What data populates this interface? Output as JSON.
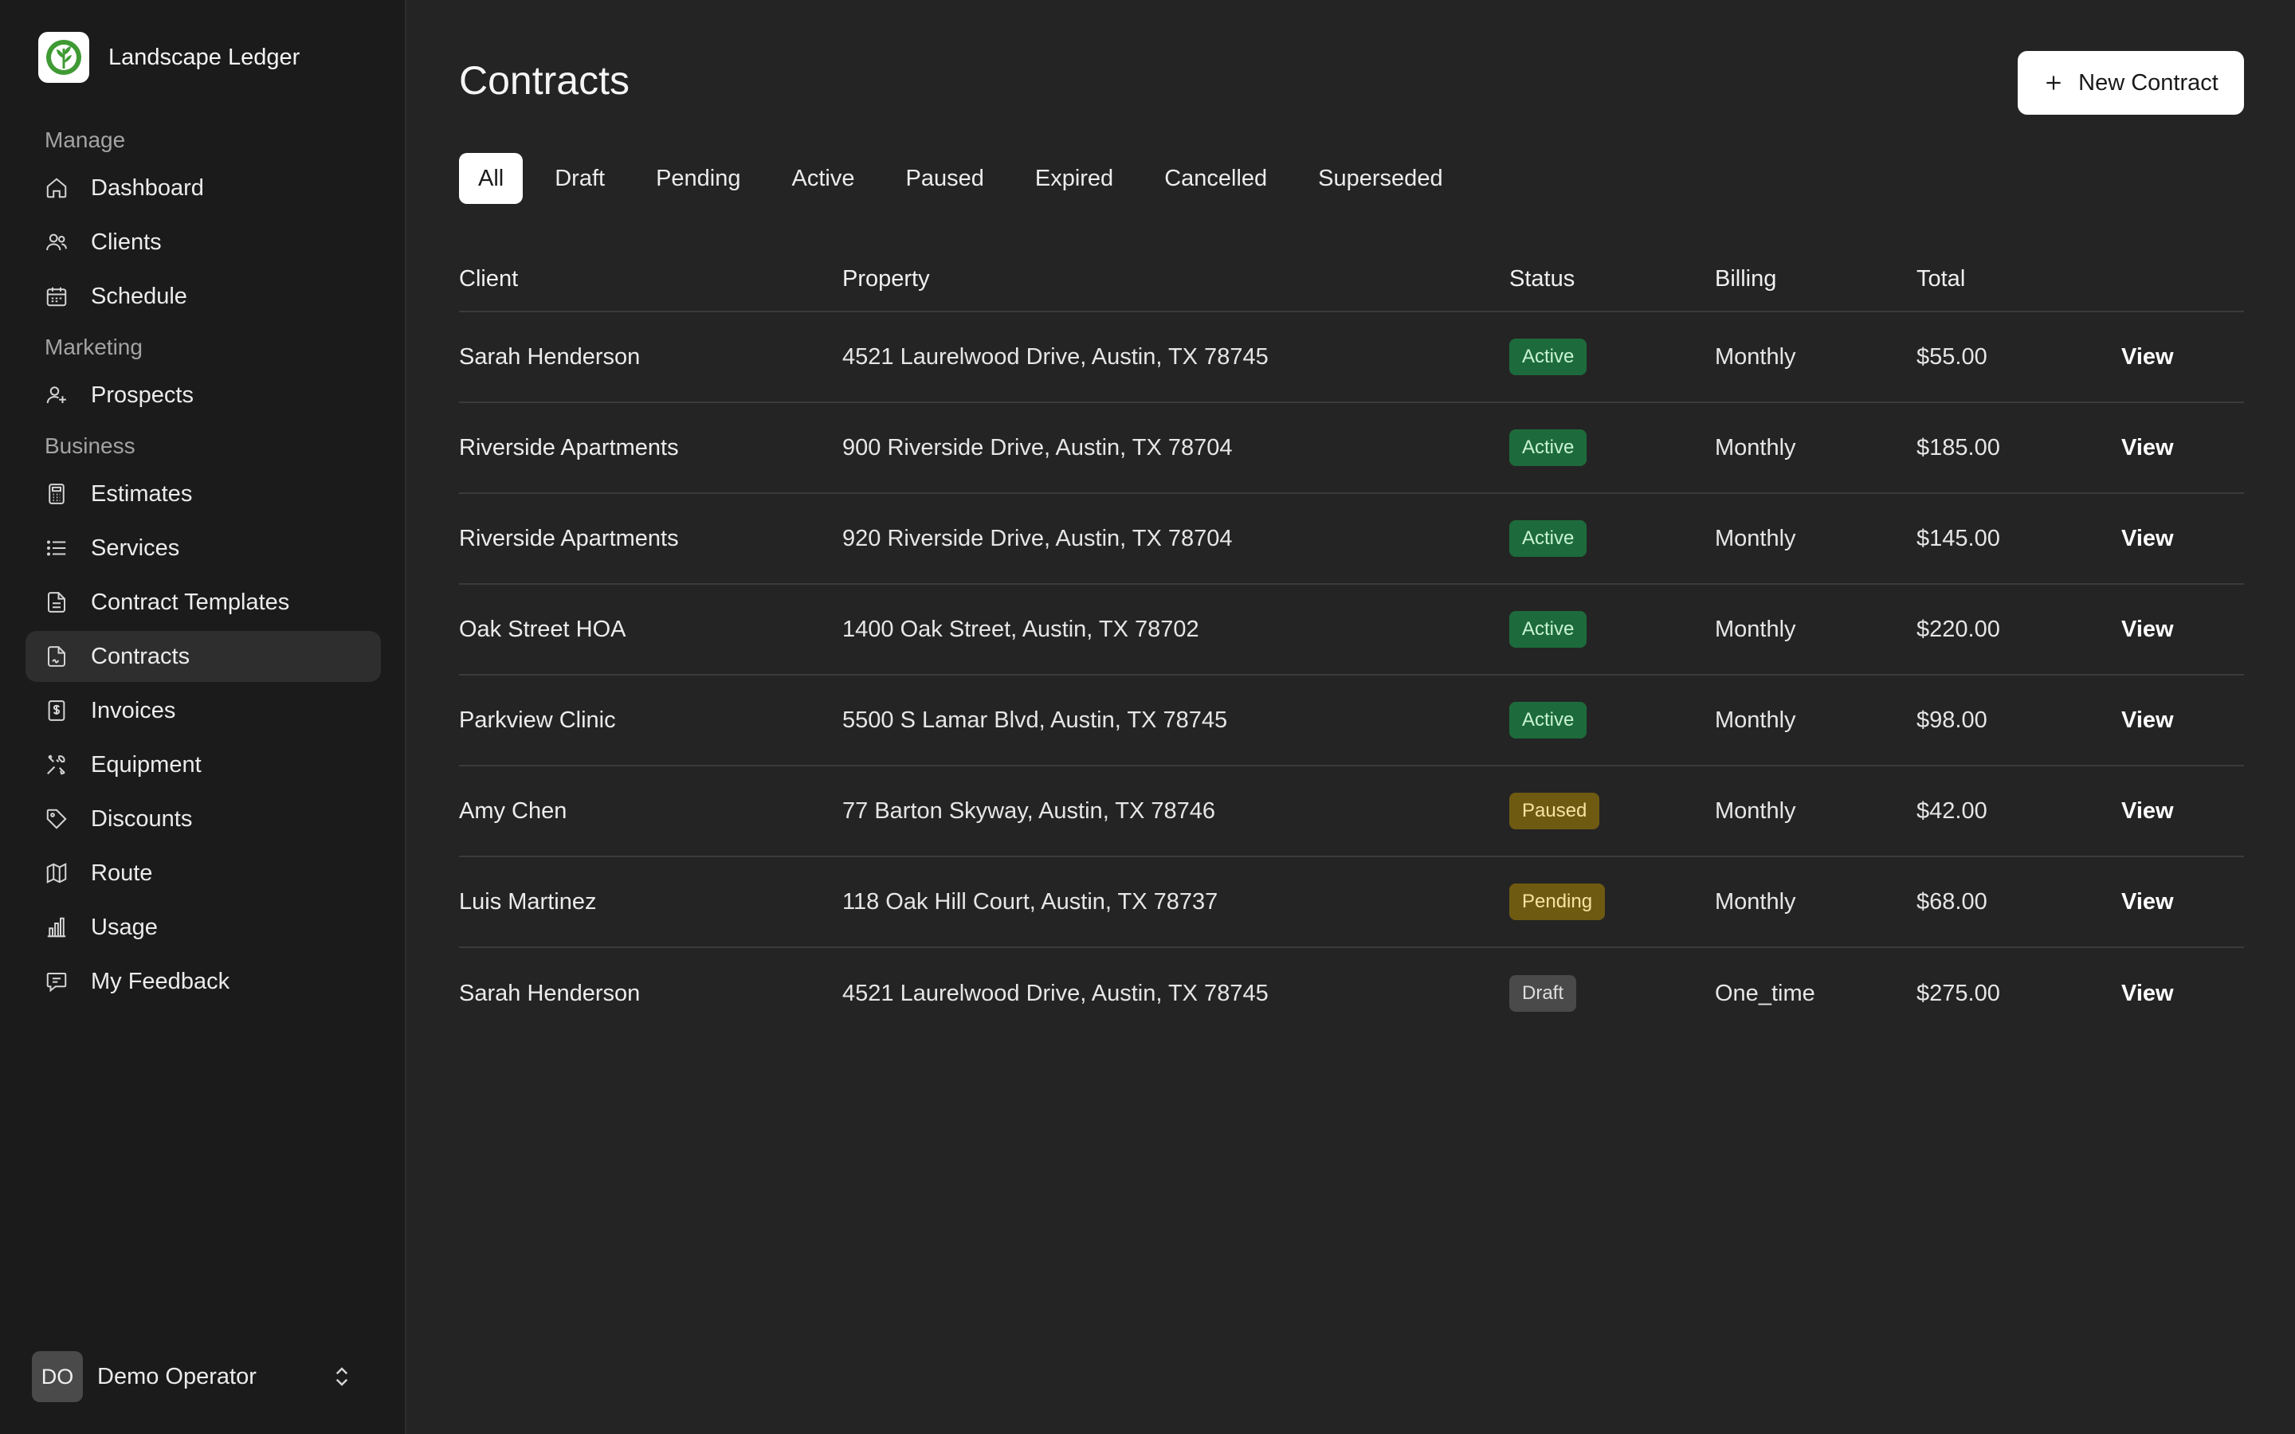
{
  "app": {
    "name": "Landscape Ledger"
  },
  "sidebar": {
    "sections": [
      {
        "label": "Manage",
        "items": [
          {
            "label": "Dashboard",
            "icon": "home-icon"
          },
          {
            "label": "Clients",
            "icon": "users-icon"
          },
          {
            "label": "Schedule",
            "icon": "calendar-icon"
          }
        ]
      },
      {
        "label": "Marketing",
        "items": [
          {
            "label": "Prospects",
            "icon": "user-plus-icon"
          }
        ]
      },
      {
        "label": "Business",
        "items": [
          {
            "label": "Estimates",
            "icon": "calculator-icon"
          },
          {
            "label": "Services",
            "icon": "list-icon"
          },
          {
            "label": "Contract Templates",
            "icon": "file-icon"
          },
          {
            "label": "Contracts",
            "icon": "file-signature-icon",
            "active": true
          },
          {
            "label": "Invoices",
            "icon": "receipt-icon"
          },
          {
            "label": "Equipment",
            "icon": "tools-icon"
          },
          {
            "label": "Discounts",
            "icon": "tag-icon"
          },
          {
            "label": "Route",
            "icon": "map-icon"
          },
          {
            "label": "Usage",
            "icon": "bar-chart-icon"
          },
          {
            "label": "My Feedback",
            "icon": "message-icon"
          }
        ]
      }
    ],
    "user": {
      "initials": "DO",
      "name": "Demo Operator"
    }
  },
  "main": {
    "title": "Contracts",
    "new_button": "New Contract",
    "tabs": [
      "All",
      "Draft",
      "Pending",
      "Active",
      "Paused",
      "Expired",
      "Cancelled",
      "Superseded"
    ],
    "active_tab": "All",
    "columns": {
      "client": "Client",
      "property": "Property",
      "status": "Status",
      "billing": "Billing",
      "total": "Total"
    },
    "rows": [
      {
        "client": "Sarah Henderson",
        "property": "4521 Laurelwood Drive, Austin, TX 78745",
        "status": "Active",
        "billing": "Monthly",
        "total": "$55.00",
        "action": "View"
      },
      {
        "client": "Riverside Apartments",
        "property": "900 Riverside Drive, Austin, TX 78704",
        "status": "Active",
        "billing": "Monthly",
        "total": "$185.00",
        "action": "View"
      },
      {
        "client": "Riverside Apartments",
        "property": "920 Riverside Drive, Austin, TX 78704",
        "status": "Active",
        "billing": "Monthly",
        "total": "$145.00",
        "action": "View"
      },
      {
        "client": "Oak Street HOA",
        "property": "1400 Oak Street, Austin, TX 78702",
        "status": "Active",
        "billing": "Monthly",
        "total": "$220.00",
        "action": "View"
      },
      {
        "client": "Parkview Clinic",
        "property": "5500 S Lamar Blvd, Austin, TX 78745",
        "status": "Active",
        "billing": "Monthly",
        "total": "$98.00",
        "action": "View"
      },
      {
        "client": "Amy Chen",
        "property": "77 Barton Skyway, Austin, TX 78746",
        "status": "Paused",
        "billing": "Monthly",
        "total": "$42.00",
        "action": "View"
      },
      {
        "client": "Luis Martinez",
        "property": "118 Oak Hill Court, Austin, TX 78737",
        "status": "Pending",
        "billing": "Monthly",
        "total": "$68.00",
        "action": "View"
      },
      {
        "client": "Sarah Henderson",
        "property": "4521 Laurelwood Drive, Austin, TX 78745",
        "status": "Draft",
        "billing": "One_time",
        "total": "$275.00",
        "action": "View"
      }
    ]
  },
  "colors": {
    "background": "#242424",
    "sidebar": "#1b1b1b",
    "status_active": "#1d6b3c",
    "status_paused": "#6f5a12",
    "status_pending": "#6f5a12",
    "status_draft": "#4a4a4a",
    "brand_green": "#3f9a34"
  }
}
